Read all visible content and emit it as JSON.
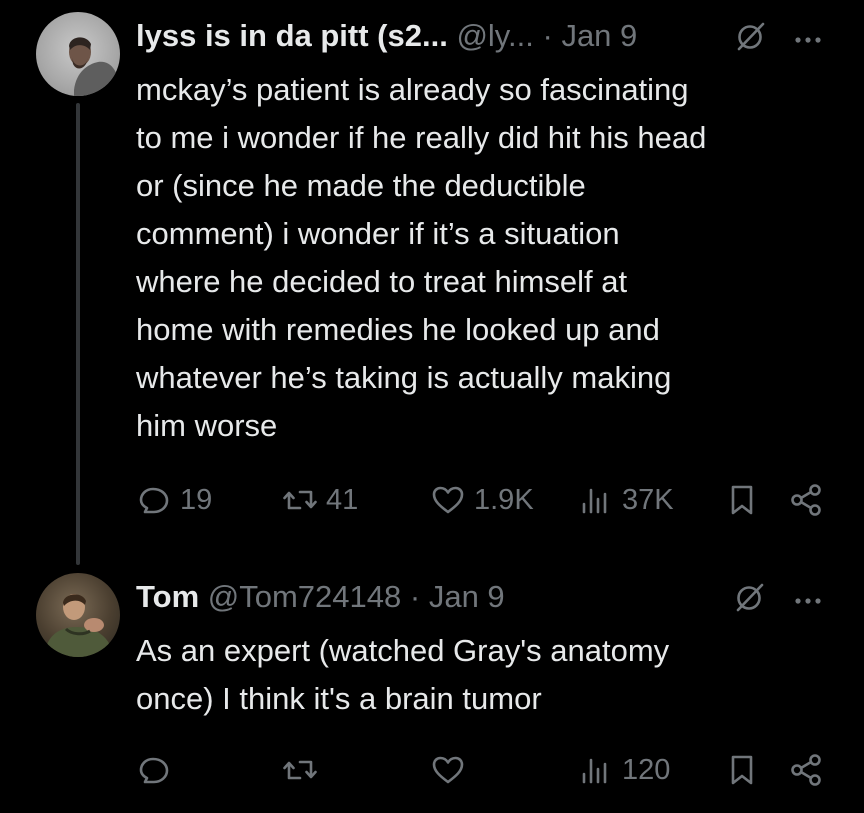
{
  "tweets": [
    {
      "author_name": "lyss is in da pitt (s2...",
      "handle": "@ly...",
      "separator": "·",
      "date": "Jan 9",
      "body_lines": [
        "mckay’s patient is already so fascinating",
        "to me i wonder if he really did hit his head",
        "or (since he made the deductible",
        "comment) i wonder if it’s a situation",
        "where he decided to treat himself at",
        "home with remedies he looked up and",
        "whatever he’s taking is actually making",
        "him worse"
      ],
      "replies": "19",
      "reposts": "41",
      "likes": "1.9K",
      "views": "37K"
    },
    {
      "author_name": "Tom",
      "handle": "@Tom724148",
      "separator": "·",
      "date": "Jan 9",
      "body_lines": [
        "As an expert (watched Gray's anatomy",
        "once) I think it's a brain tumor"
      ],
      "replies": "",
      "reposts": "",
      "likes": "",
      "views": "120"
    }
  ],
  "icons": {
    "reply": "reply-icon",
    "repost": "repost-icon",
    "like": "like-icon",
    "views": "views-icon",
    "bookmark": "bookmark-icon",
    "share": "share-icon",
    "grok": "grok-icon",
    "more": "more-icon"
  },
  "colors": {
    "background": "#000000",
    "text": "#e7e9ea",
    "muted": "#71767b",
    "thread_line": "#333639"
  }
}
